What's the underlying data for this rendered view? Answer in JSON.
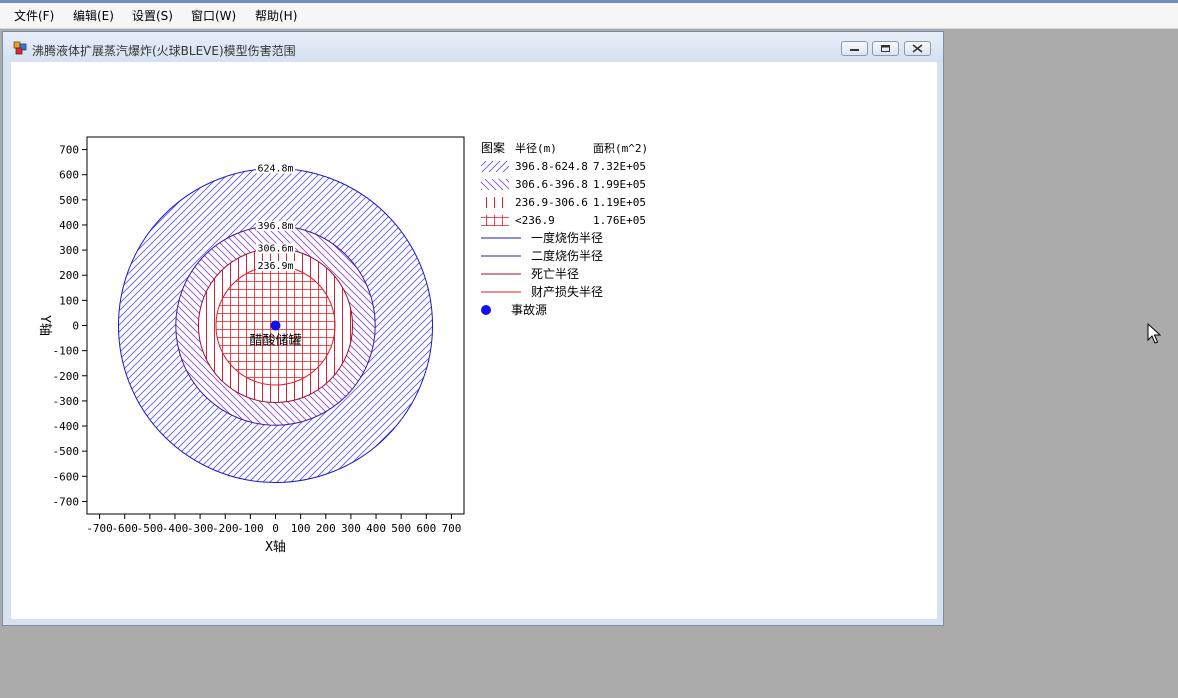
{
  "menubar": {
    "items": [
      {
        "label": "文件(F)"
      },
      {
        "label": "编辑(E)"
      },
      {
        "label": "设置(S)"
      },
      {
        "label": "窗口(W)"
      },
      {
        "label": "帮助(H)"
      }
    ]
  },
  "window": {
    "title": "沸腾液体扩展蒸汽爆炸(火球BLEVE)模型伤害范围"
  },
  "chart_data": {
    "type": "scatter",
    "xlabel": "X轴",
    "ylabel": "Y轴",
    "xlim": [
      -750,
      750
    ],
    "ylim": [
      -750,
      750
    ],
    "xticks": [
      -700,
      -600,
      -500,
      -400,
      -300,
      -200,
      -100,
      0,
      100,
      200,
      300,
      400,
      500,
      600,
      700
    ],
    "yticks": [
      -700,
      -600,
      -500,
      -400,
      -300,
      -200,
      -100,
      0,
      100,
      200,
      300,
      400,
      500,
      600,
      700
    ],
    "grid": false,
    "source": {
      "x": 0,
      "y": 0,
      "label": "醋酸储罐"
    },
    "circles": [
      {
        "radius": 624.8,
        "label": "624.8m",
        "color": "#1a1acc",
        "pattern": "hatch-forward"
      },
      {
        "radius": 396.8,
        "label": "396.8m",
        "color": "#3a1a9c",
        "pattern": "hatch-backward"
      },
      {
        "radius": 306.6,
        "label": "306.6m",
        "color": "#a0102a",
        "pattern": "vertical"
      },
      {
        "radius": 236.9,
        "label": "236.9m",
        "color": "#e01b24",
        "pattern": "cross"
      }
    ],
    "legend": {
      "placement": "right",
      "header": {
        "pattern": "图案",
        "radius": "半径(m)",
        "area": "面积(m^2)"
      },
      "rows": [
        {
          "range": "396.8-624.8",
          "area": "7.32E+05",
          "color": "#5a5aee",
          "pattern": "hatch-forward"
        },
        {
          "range": "306.6-396.8",
          "area": "1.99E+05",
          "color": "#8a4ad0",
          "pattern": "hatch-backward"
        },
        {
          "range": "236.9-306.6",
          "area": "1.19E+05",
          "color": "#c0102a",
          "pattern": "vertical"
        },
        {
          "range": "<236.9",
          "area": "1.76E+05",
          "color": "#e01b24",
          "pattern": "cross"
        }
      ],
      "lines": [
        {
          "label": "一度烧伤半径",
          "color": "#1a1acc"
        },
        {
          "label": "二度烧伤半径",
          "color": "#3a1a9c"
        },
        {
          "label": "死亡半径",
          "color": "#a0102a"
        },
        {
          "label": "财产损失半径",
          "color": "#e01b24"
        }
      ],
      "marker": {
        "label": "事故源",
        "color": "#1010ee"
      }
    }
  }
}
